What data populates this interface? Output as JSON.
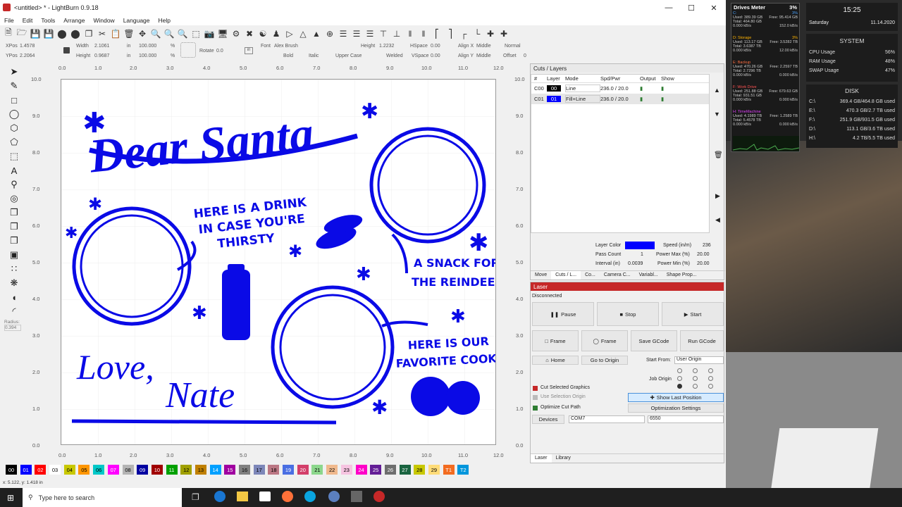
{
  "window": {
    "title": "<untitled> * - LightBurn 0.9.18"
  },
  "menu": [
    "File",
    "Edit",
    "Tools",
    "Arrange",
    "Window",
    "Language",
    "Help"
  ],
  "toolbar2": {
    "xpos_label": "XPos",
    "xpos": "1.4578",
    "ypos_label": "YPos",
    "ypos": "2.2064",
    "width_label": "Width",
    "width": "2.1061",
    "height_label": "Height",
    "height": "0.9687",
    "unit1": "in",
    "unit2": "in",
    "scale_w": "100.000",
    "scale_h": "100.000",
    "pct": "%",
    "rotate_label": "Rotate",
    "rotate": "0.0",
    "font_label": "Font",
    "font": "Alex Brush",
    "height2_label": "Height",
    "height2": "1.2232",
    "hspace_label": "HSpace",
    "hspace": "0.00",
    "vspace_label": "VSpace",
    "vspace": "0.00",
    "align_x_label": "Align X",
    "align_x": "Middle",
    "align_y_label": "Align Y",
    "align_y": "Middle",
    "normal": "Normal",
    "offset_label": "Offset",
    "offset": "0",
    "bold": "Bold",
    "italic": "Italic",
    "upper": "Upper Case",
    "welded": "Welded"
  },
  "ruler": {
    "x": [
      "0.0",
      "1.0",
      "2.0",
      "3.0",
      "4.0",
      "5.0",
      "6.0",
      "7.0",
      "8.0",
      "9.0",
      "10.0",
      "11.0",
      "12.0"
    ],
    "y": [
      "10.0",
      "9.0",
      "8.0",
      "7.0",
      "6.0",
      "5.0",
      "4.0",
      "3.0",
      "2.0",
      "1.0",
      "0.0"
    ]
  },
  "left_tools": {
    "radius_label": "Radius:",
    "radius": "0.394"
  },
  "design": {
    "title": "Dear Santa",
    "drink": [
      "HERE IS A DRINK",
      "IN CASE YOU'RE",
      "THIRSTY"
    ],
    "snack": [
      "A SNACK FOR",
      "THE REINDEER"
    ],
    "cookie": [
      "HERE IS OUR",
      "FAVORITE COOKIE"
    ],
    "love": "Love,",
    "name": "Nate"
  },
  "palette": [
    {
      "l": "00",
      "c": "#000000",
      "t": "#fff"
    },
    {
      "l": "01",
      "c": "#0000ff",
      "t": "#fff"
    },
    {
      "l": "02",
      "c": "#ff0000",
      "t": "#fff"
    },
    {
      "l": "03",
      "c": "#ffffff",
      "t": "#000"
    },
    {
      "l": "04",
      "c": "#c8c800",
      "t": "#000"
    },
    {
      "l": "05",
      "c": "#ff9600",
      "t": "#000"
    },
    {
      "l": "06",
      "c": "#00c8c8",
      "t": "#000"
    },
    {
      "l": "07",
      "c": "#ff00ff",
      "t": "#fff"
    },
    {
      "l": "08",
      "c": "#b4b4b4",
      "t": "#000"
    },
    {
      "l": "09",
      "c": "#0000a0",
      "t": "#fff"
    },
    {
      "l": "10",
      "c": "#a00000",
      "t": "#fff"
    },
    {
      "l": "11",
      "c": "#00a000",
      "t": "#fff"
    },
    {
      "l": "12",
      "c": "#a0a000",
      "t": "#000"
    },
    {
      "l": "13",
      "c": "#c08000",
      "t": "#000"
    },
    {
      "l": "14",
      "c": "#00a0ff",
      "t": "#fff"
    },
    {
      "l": "15",
      "c": "#a000a0",
      "t": "#fff"
    },
    {
      "l": "16",
      "c": "#808080",
      "t": "#000"
    },
    {
      "l": "17",
      "c": "#7d87b9",
      "t": "#000"
    },
    {
      "l": "18",
      "c": "#bb7784",
      "t": "#000"
    },
    {
      "l": "19",
      "c": "#4a6fe3",
      "t": "#fff"
    },
    {
      "l": "20",
      "c": "#d33f6a",
      "t": "#fff"
    },
    {
      "l": "21",
      "c": "#8cd78c",
      "t": "#000"
    },
    {
      "l": "22",
      "c": "#f0b98d",
      "t": "#000"
    },
    {
      "l": "23",
      "c": "#f6c4e1",
      "t": "#000"
    },
    {
      "l": "24",
      "c": "#fe00c8",
      "t": "#fff"
    },
    {
      "l": "25",
      "c": "#641e96",
      "t": "#fff"
    },
    {
      "l": "26",
      "c": "#6e6e6e",
      "t": "#fff"
    },
    {
      "l": "27",
      "c": "#1a6440",
      "t": "#fff"
    },
    {
      "l": "28",
      "c": "#c8c800",
      "t": "#000"
    },
    {
      "l": "29",
      "c": "#ffdc78",
      "t": "#000"
    },
    {
      "l": "T1",
      "c": "#f36c21",
      "t": "#fff"
    },
    {
      "l": "T2",
      "c": "#0096dc",
      "t": "#fff"
    }
  ],
  "status": "x: 5.122, y: 1.418 in",
  "cuts": {
    "title": "Cuts / Layers",
    "headers": [
      "#",
      "Layer",
      "Mode",
      "Spd/Pwr",
      "Output",
      "Show"
    ],
    "rows": [
      {
        "n": "C00",
        "layer": "00",
        "color": "#000000",
        "mode": "Line",
        "spd": "236.0 / 20.0"
      },
      {
        "n": "C01",
        "layer": "01",
        "color": "#0000ff",
        "mode": "Fill+Line",
        "spd": "236.0 / 20.0"
      }
    ],
    "layer_color_label": "Layer Color",
    "speed_label": "Speed (in/m)",
    "speed": "236",
    "pass_label": "Pass Count",
    "pass": "1",
    "pmax_label": "Power Max (%)",
    "pmax": "20.00",
    "interval_label": "Interval (in)",
    "interval": "0.0039",
    "pmin_label": "Power Min (%)",
    "pmin": "20.00",
    "tabs": [
      "Move",
      "Cuts / L...",
      "Co...",
      "Camera C...",
      "Variabl...",
      "Shape Prop..."
    ]
  },
  "laser": {
    "title": "Laser",
    "status": "Disconnected",
    "pause": "Pause",
    "stop": "Stop",
    "start": "Start",
    "frame1": "Frame",
    "frame2": "Frame",
    "save_gcode": "Save GCode",
    "run_gcode": "Run GCode",
    "home": "Home",
    "goto_origin": "Go to Origin",
    "start_from_label": "Start From:",
    "start_from": "User Origin",
    "job_origin_label": "Job Origin",
    "cut_selected": "Cut Selected Graphics",
    "use_selection": "Use Selection Origin",
    "optimize": "Optimize Cut Path",
    "show_last": "Show Last Position",
    "opt_settings": "Optimization Settings",
    "devices": "Devices",
    "port": "COM7",
    "device": "6550",
    "tabs": [
      "Laser",
      "Library"
    ]
  },
  "taskbar": {
    "search": "Type here to search"
  },
  "drives": {
    "title": "Drives Meter",
    "pct": "3%",
    "items": [
      {
        "name": "C:",
        "pct": "3%",
        "used": "Used: 389.39 GB",
        "free": "Free: 95.414 GB",
        "total": "Total: 464.80 GB",
        "rw": "0.000 kB/s",
        "rw2": "152.0 kB/s",
        "color": "#4aa3ff"
      },
      {
        "name": "D: Storage",
        "pct": "3%",
        "used": "Used: 113.17 GB",
        "free": "Free: 3.5282 TB",
        "total": "Total: 3.6387 TB",
        "rw": "0.000 kB/s",
        "rw2": "12.00 kB/s",
        "color": "#ffb300"
      },
      {
        "name": "E: Backup",
        "pct": "",
        "used": "Used: 470.26 GB",
        "free": "Free: 2.2597 TB",
        "total": "Total: 2.7296 TB",
        "rw": "0.000 kB/s",
        "rw2": "0.000 kB/s",
        "color": "#ff7043"
      },
      {
        "name": "F: Work Drive",
        "pct": "",
        "used": "Used: 251.88 GB",
        "free": "Free: 679.63 GB",
        "total": "Total: 931.51 GB",
        "rw": "0.000 kB/s",
        "rw2": "0.000 kB/s",
        "color": "#ff5252"
      },
      {
        "name": "H: TimeMachine",
        "pct": "",
        "used": "Used: 4.1989 TB",
        "free": "Free: 1.2589 TB",
        "total": "Total: 5.4578 TB",
        "rw": "0.000 kB/s",
        "rw2": "0.000 kB/s",
        "color": "#e040fb"
      }
    ]
  },
  "clock": {
    "time": "15:25",
    "day": "Saturday",
    "date": "11.14.2020"
  },
  "system": {
    "title": "SYSTEM",
    "rows": [
      {
        "l": "CPU Usage",
        "v": "56%"
      },
      {
        "l": "RAM Usage",
        "v": "48%"
      },
      {
        "l": "SWAP Usage",
        "v": "47%"
      }
    ]
  },
  "disk": {
    "title": "DISK",
    "rows": [
      {
        "l": "C:\\",
        "v": "369.4 GB/464.8 GB used"
      },
      {
        "l": "E:\\",
        "v": "470.3 GB/2.7 TB used"
      },
      {
        "l": "F:\\",
        "v": "251.9 GB/931.5 GB used"
      },
      {
        "l": "D:\\",
        "v": "113.1 GB/3.6 TB used"
      },
      {
        "l": "H:\\",
        "v": "4.2 TB/5.5 TB used"
      }
    ]
  }
}
